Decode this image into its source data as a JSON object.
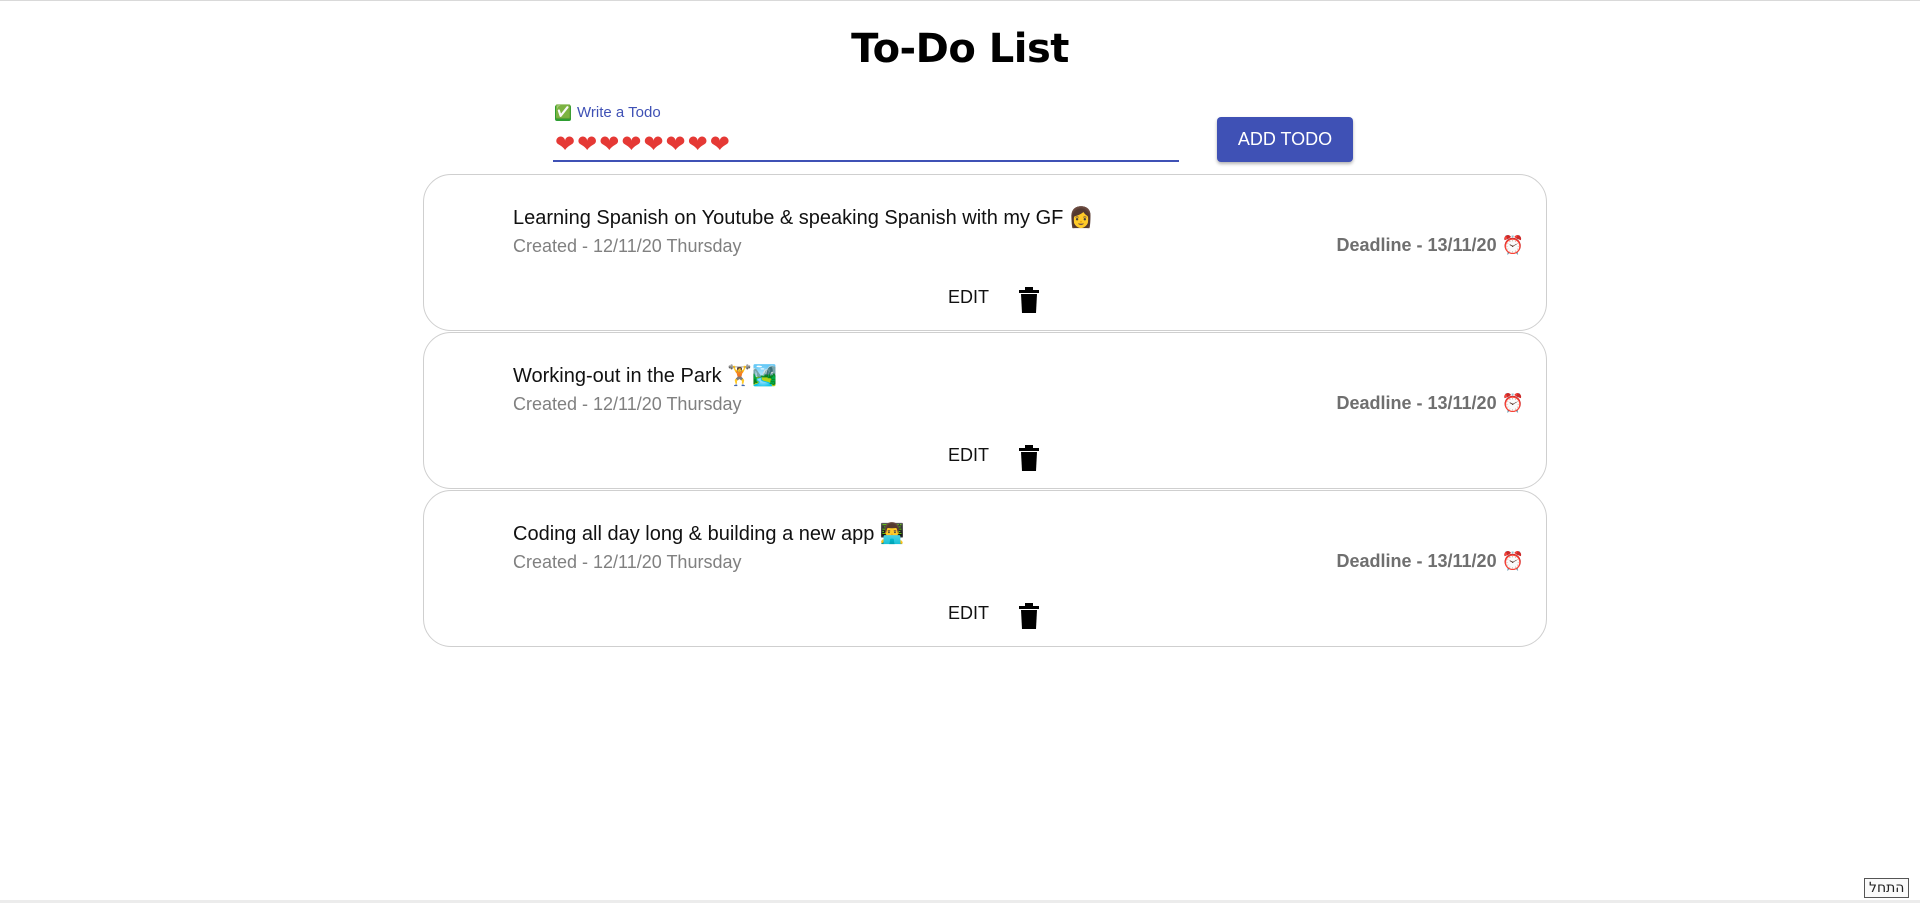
{
  "header": {
    "title": "To-Do List"
  },
  "form": {
    "label_icon": "✅",
    "label": "Write a Todo",
    "input_value": "❤❤❤❤❤❤❤❤",
    "add_button_label": "ADD TODO"
  },
  "todos": [
    {
      "text": "Learning Spanish on Youtube & speaking Spanish with my GF 👩",
      "created": "Created - 12/11/20 Thursday",
      "deadline": "Deadline - 13/11/20 ⏰",
      "edit_label": "EDIT"
    },
    {
      "text": "Working-out in the Park 🏋️🏞️",
      "created": "Created - 12/11/20 Thursday",
      "deadline": "Deadline - 13/11/20 ⏰",
      "edit_label": "EDIT"
    },
    {
      "text": "Coding all day long & building a new app 👨‍💻",
      "created": "Created - 12/11/20 Thursday",
      "deadline": "Deadline - 13/11/20 ⏰",
      "edit_label": "EDIT"
    }
  ],
  "taskbar": {
    "lang_label": "התחל"
  },
  "colors": {
    "primary": "#3f51b5",
    "check": "#2e9e32",
    "heart": "#e53935",
    "muted_text": "#808080"
  }
}
